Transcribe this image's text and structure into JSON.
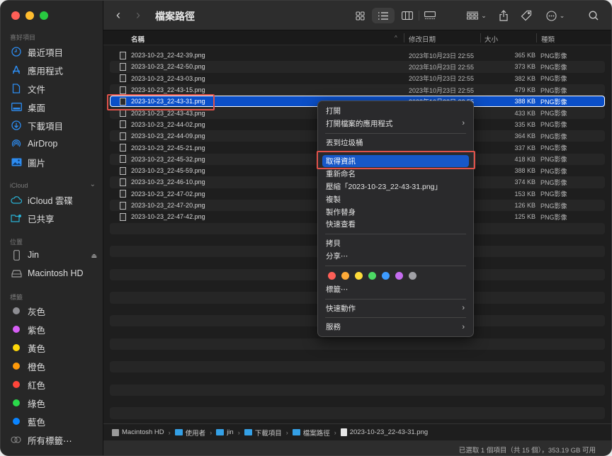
{
  "window": {
    "traffic_lights": [
      "#fe5f57",
      "#febc2e",
      "#28c840"
    ]
  },
  "sidebar": {
    "sections": [
      {
        "title": "喜好項目",
        "items": [
          {
            "label": "最近項目",
            "icon": "clock-icon"
          },
          {
            "label": "應用程式",
            "icon": "applications-icon"
          },
          {
            "label": "文件",
            "icon": "document-icon"
          },
          {
            "label": "桌面",
            "icon": "desktop-icon"
          },
          {
            "label": "下載項目",
            "icon": "download-icon"
          },
          {
            "label": "AirDrop",
            "icon": "airdrop-icon"
          },
          {
            "label": "圖片",
            "icon": "pictures-icon"
          }
        ]
      },
      {
        "title": "iCloud",
        "items": [
          {
            "label": "iCloud 雲碟",
            "icon": "cloud-icon"
          },
          {
            "label": "已共享",
            "icon": "shared-folder-icon"
          }
        ]
      },
      {
        "title": "位置",
        "items": [
          {
            "label": "Jin",
            "icon": "iphone-icon"
          },
          {
            "label": "Macintosh HD",
            "icon": "hard-drive-icon"
          }
        ]
      },
      {
        "title": "標籤",
        "items": [
          {
            "label": "灰色",
            "color": "#8e8e93"
          },
          {
            "label": "紫色",
            "color": "#d65ef5"
          },
          {
            "label": "黃色",
            "color": "#fed709"
          },
          {
            "label": "橙色",
            "color": "#fe9a0a"
          },
          {
            "label": "紅色",
            "color": "#fe453a"
          },
          {
            "label": "綠色",
            "color": "#2ad94a"
          },
          {
            "label": "藍色",
            "color": "#0a84ff"
          },
          {
            "label": "所有標籤⋯",
            "icon": "all-tags-icon"
          }
        ]
      }
    ]
  },
  "toolbar": {
    "back": "‹",
    "forward": "›",
    "title": "檔案路徑"
  },
  "columns": {
    "name": "名稱",
    "date": "修改日期",
    "size": "大小",
    "kind": "種類"
  },
  "files": [
    {
      "name": "2023-10-23_22-42-39.png",
      "date": "2023年10月23日 22:55",
      "size": "365 KB",
      "kind": "PNG影像"
    },
    {
      "name": "2023-10-23_22-42-50.png",
      "date": "2023年10月23日 22:55",
      "size": "373 KB",
      "kind": "PNG影像"
    },
    {
      "name": "2023-10-23_22-43-03.png",
      "date": "2023年10月23日 22:55",
      "size": "382 KB",
      "kind": "PNG影像"
    },
    {
      "name": "2023-10-23_22-43-15.png",
      "date": "2023年10月23日 22:55",
      "size": "479 KB",
      "kind": "PNG影像"
    },
    {
      "name": "2023-10-23_22-43-31.png",
      "date": "2023年10月23日 22:55",
      "size": "388 KB",
      "kind": "PNG影像",
      "selected": true
    },
    {
      "name": "2023-10-23_22-43-43.png",
      "date": "",
      "size": "433 KB",
      "kind": "PNG影像"
    },
    {
      "name": "2023-10-23_22-44-02.png",
      "date": "",
      "size": "335 KB",
      "kind": "PNG影像"
    },
    {
      "name": "2023-10-23_22-44-09.png",
      "date": "",
      "size": "364 KB",
      "kind": "PNG影像"
    },
    {
      "name": "2023-10-23_22-45-21.png",
      "date": "",
      "size": "337 KB",
      "kind": "PNG影像"
    },
    {
      "name": "2023-10-23_22-45-32.png",
      "date": "",
      "size": "418 KB",
      "kind": "PNG影像"
    },
    {
      "name": "2023-10-23_22-45-59.png",
      "date": "",
      "size": "388 KB",
      "kind": "PNG影像"
    },
    {
      "name": "2023-10-23_22-46-10.png",
      "date": "",
      "size": "374 KB",
      "kind": "PNG影像"
    },
    {
      "name": "2023-10-23_22-47-02.png",
      "date": "",
      "size": "153 KB",
      "kind": "PNG影像"
    },
    {
      "name": "2023-10-23_22-47-20.png",
      "date": "",
      "size": "126 KB",
      "kind": "PNG影像"
    },
    {
      "name": "2023-10-23_22-47-42.png",
      "date": "",
      "size": "125 KB",
      "kind": "PNG影像"
    }
  ],
  "context_menu": {
    "items": [
      {
        "label": "打開"
      },
      {
        "label": "打開檔案的應用程式",
        "submenu": true
      },
      {
        "separator": true
      },
      {
        "label": "丟到垃圾桶"
      },
      {
        "separator": true
      },
      {
        "label": "取得資訊",
        "highlighted": true
      },
      {
        "label": "重新命名"
      },
      {
        "label": "壓縮「2023-10-23_22-43-31.png」"
      },
      {
        "label": "複製"
      },
      {
        "label": "製作替身"
      },
      {
        "label": "快速查看"
      },
      {
        "separator": true
      },
      {
        "label": "拷貝"
      },
      {
        "label": "分享⋯"
      },
      {
        "separator": true
      },
      {
        "tags": [
          "#fe5f57",
          "#feaa38",
          "#fedb3a",
          "#4cd964",
          "#3d9bff",
          "#c56cf0",
          "#a0a0a5"
        ]
      },
      {
        "label": "標籤⋯"
      },
      {
        "separator": true
      },
      {
        "label": "快速動作",
        "submenu": true
      },
      {
        "separator": true
      },
      {
        "label": "服務",
        "submenu": true
      }
    ]
  },
  "pathbar": {
    "crumbs": [
      {
        "label": "Macintosh HD",
        "icon": "hard-drive-icon"
      },
      {
        "label": "使用者",
        "icon": "folder-icon"
      },
      {
        "label": "jin",
        "icon": "home-folder-icon"
      },
      {
        "label": "下載項目",
        "icon": "downloads-folder-icon"
      },
      {
        "label": "檔案路徑",
        "icon": "folder-icon"
      },
      {
        "label": "2023-10-23_22-43-31.png",
        "icon": "png-file-icon"
      }
    ],
    "separator": "›"
  },
  "status": {
    "text": "已選取 1 個項目（共 15 個），353.19 GB 可用"
  }
}
